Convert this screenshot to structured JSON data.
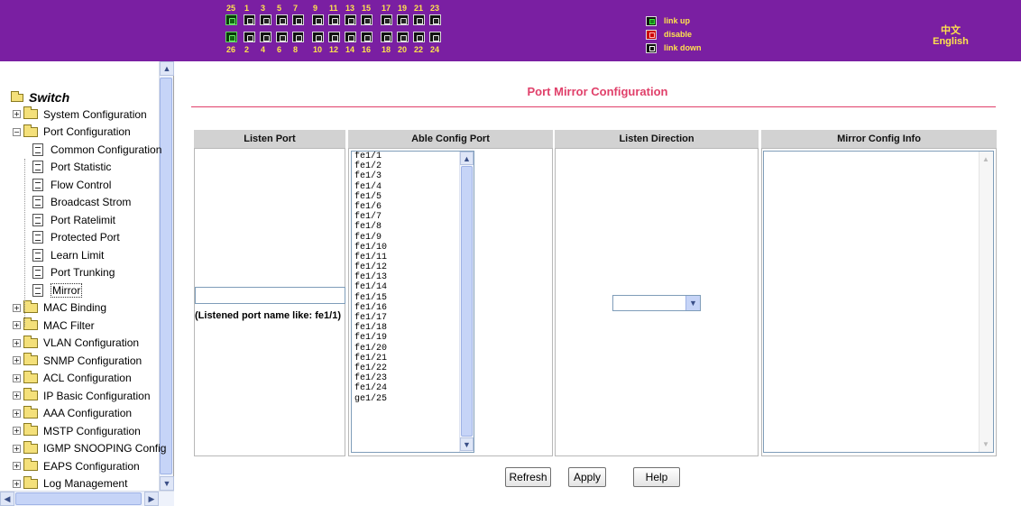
{
  "header": {
    "port_numbers_top": [
      "25",
      "1",
      "3",
      "5",
      "7",
      "9",
      "11",
      "13",
      "15",
      "17",
      "19",
      "21",
      "23"
    ],
    "port_numbers_bottom": [
      "26",
      "2",
      "4",
      "6",
      "8",
      "10",
      "12",
      "14",
      "16",
      "18",
      "20",
      "22",
      "24"
    ],
    "legend": [
      {
        "label": "link up",
        "color": "#1a801a",
        "icon": "link-up-icon"
      },
      {
        "label": "disable",
        "color": "#cc0000",
        "icon": "disable-icon"
      },
      {
        "label": "link down",
        "color": "#111111",
        "icon": "link-down-icon"
      }
    ],
    "lang_chinese": "中文",
    "lang_english": "English",
    "accent_color": "#7a1fa2"
  },
  "sidebar": {
    "root_label": "Switch",
    "items": [
      {
        "label": "System Configuration",
        "type": "folder",
        "expanded": false
      },
      {
        "label": "Port Configuration",
        "type": "folder",
        "expanded": true
      },
      {
        "label": "Common Configuration",
        "type": "page"
      },
      {
        "label": "Port Statistic",
        "type": "page"
      },
      {
        "label": "Flow Control",
        "type": "page"
      },
      {
        "label": "Broadcast Strom",
        "type": "page"
      },
      {
        "label": "Port Ratelimit",
        "type": "page"
      },
      {
        "label": "Protected Port",
        "type": "page"
      },
      {
        "label": "Learn Limit",
        "type": "page"
      },
      {
        "label": "Port Trunking",
        "type": "page"
      },
      {
        "label": "Mirror",
        "type": "page",
        "selected": true
      },
      {
        "label": "MAC Binding",
        "type": "folder",
        "expanded": false
      },
      {
        "label": "MAC Filter",
        "type": "folder",
        "expanded": false
      },
      {
        "label": "VLAN Configuration",
        "type": "folder",
        "expanded": false
      },
      {
        "label": "SNMP Configuration",
        "type": "folder",
        "expanded": false
      },
      {
        "label": "ACL Configuration",
        "type": "folder",
        "expanded": false
      },
      {
        "label": "IP Basic Configuration",
        "type": "folder",
        "expanded": false
      },
      {
        "label": "AAA Configuration",
        "type": "folder",
        "expanded": false
      },
      {
        "label": "MSTP Configuration",
        "type": "folder",
        "expanded": false
      },
      {
        "label": "IGMP SNOOPING Config",
        "type": "folder",
        "expanded": false
      },
      {
        "label": "EAPS Configuration",
        "type": "folder",
        "expanded": false
      },
      {
        "label": "Log Management",
        "type": "folder",
        "expanded": false
      }
    ]
  },
  "main": {
    "title": "Port Mirror Configuration",
    "title_color": "#e0406a",
    "columns": [
      "Listen Port",
      "Able Config Port",
      "Listen Direction",
      "Mirror Config Info"
    ],
    "listen_port_value": "",
    "listen_port_hint": "(Listened port name like: fe1/1)",
    "able_ports": [
      "fe1/1",
      "fe1/2",
      "fe1/3",
      "fe1/4",
      "fe1/5",
      "fe1/6",
      "fe1/7",
      "fe1/8",
      "fe1/9",
      "fe1/10",
      "fe1/11",
      "fe1/12",
      "fe1/13",
      "fe1/14",
      "fe1/15",
      "fe1/16",
      "fe1/17",
      "fe1/18",
      "fe1/19",
      "fe1/20",
      "fe1/21",
      "fe1/22",
      "fe1/23",
      "fe1/24",
      "ge1/25"
    ],
    "listen_direction_value": "",
    "mirror_config_info": "",
    "buttons": {
      "refresh": "Refresh",
      "apply": "Apply",
      "help": "Help"
    }
  }
}
